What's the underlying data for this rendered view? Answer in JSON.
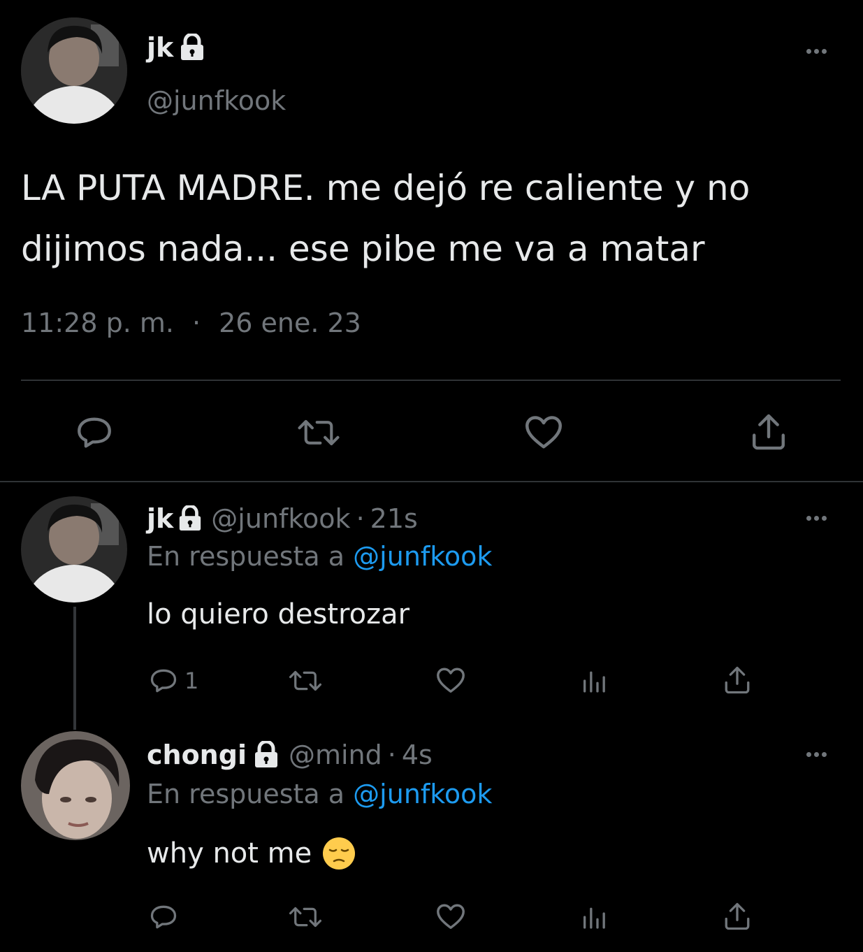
{
  "main_tweet": {
    "display_name": "jk",
    "handle": "@junfkook",
    "text_line1": "LA PUTA MADRE. me dejó re caliente y no",
    "text_line2": "dijimos nada... ese pibe me va a matar",
    "time": "11:28 p. m.",
    "separator": "·",
    "date": "26 ene. 23"
  },
  "replies": [
    {
      "display_name": "jk",
      "handle": "@junfkook",
      "sep": "·",
      "age": "21s",
      "reply_prefix": "En respuesta a",
      "reply_to": "@junfkook",
      "text": "lo quiero destrozar",
      "reply_count": "1"
    },
    {
      "display_name": "chongi",
      "handle": "@mind",
      "sep": "·",
      "age": "4s",
      "reply_prefix": "En respuesta a",
      "reply_to": "@junfkook",
      "text": "why not me",
      "emoji": "😔",
      "reply_count": ""
    }
  ],
  "colors": {
    "background": "#000000",
    "text": "#e7e9ea",
    "secondary": "#71767b",
    "link": "#1d9bf0",
    "divider": "#2f3336"
  }
}
